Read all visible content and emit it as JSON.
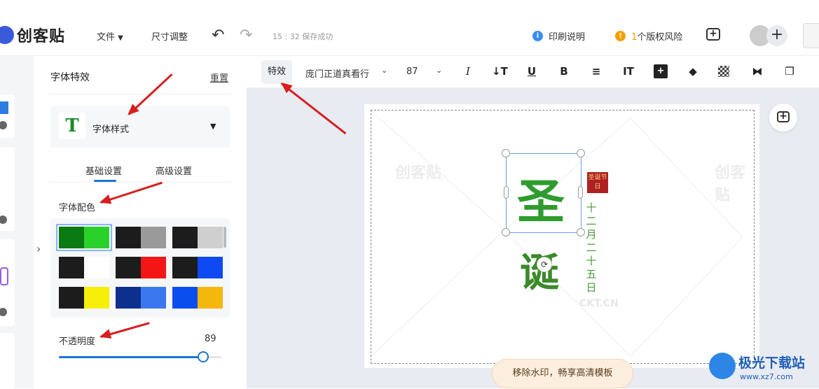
{
  "header": {
    "logo_text": "创客贴",
    "file_menu": "文件",
    "resize": "尺寸调整",
    "save_status": "15 : 32 保存成功",
    "print_info": "印刷说明",
    "copyright_count": "1",
    "copyright_text": "个版权风险"
  },
  "panel": {
    "title": "字体特效",
    "reset": "重置",
    "style_select": "字体样式",
    "style_icon": "T",
    "tabs": [
      "基础设置",
      "高级设置"
    ],
    "color_label": "字体配色",
    "opacity_label": "不透明度",
    "opacity_value": "89",
    "opacity_percent": 89,
    "swatches": [
      [
        "#0a7a12",
        "#2bd12b"
      ],
      [
        "#1c1c1c",
        "#9a9a9a"
      ],
      [
        "#1c1c1c",
        "#cfcfcf"
      ],
      [
        "#1c1c1c",
        "#ffffff"
      ],
      [
        "#1c1c1c",
        "#f41616"
      ],
      [
        "#1c1c1c",
        "#0d4af2"
      ],
      [
        "#1c1c1c",
        "#f7ee0a"
      ],
      [
        "#0d2f8e",
        "#3b78ee"
      ],
      [
        "#0b4ef0",
        "#f4b70c"
      ]
    ]
  },
  "toolbar": {
    "effects": "特效",
    "font_name": "庞门正道真看行",
    "font_size": "87",
    "tools": [
      "italic-icon",
      "letter-spacing-icon",
      "underline-icon",
      "bold-icon",
      "align-icon",
      "line-height-icon",
      "add-icon",
      "layers-icon",
      "transparency-icon",
      "flip-icon",
      "shadow-icon"
    ]
  },
  "canvas": {
    "char1": "圣",
    "char2": "诞",
    "seal_text": "圣诞节日",
    "vertical_date": [
      "十",
      "二",
      "月",
      "二",
      "十",
      "五",
      "日"
    ],
    "watermark": "创客贴",
    "watermark_url": "CKT.CN",
    "promo": "移除水印，畅享高清模板"
  },
  "site_watermark": {
    "name": "极光下载站",
    "url": "www.xz7.com"
  },
  "colors": {
    "accent": "#1976d2",
    "arrow": "#d81e1e"
  }
}
